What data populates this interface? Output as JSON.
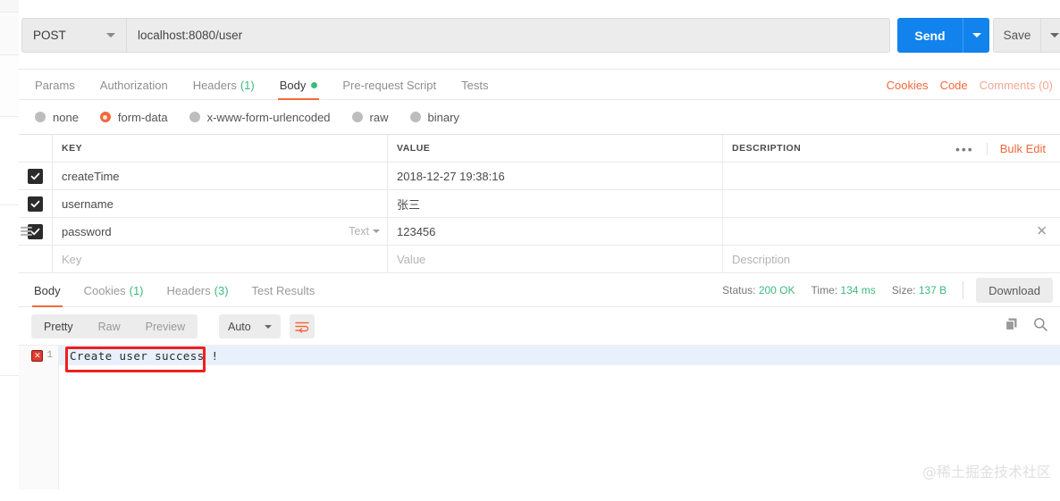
{
  "request": {
    "method": "POST",
    "url": "localhost:8080/user",
    "send_label": "Send",
    "save_label": "Save",
    "tabs": [
      {
        "label": "Params",
        "count": "",
        "active": false
      },
      {
        "label": "Authorization",
        "count": "",
        "active": false
      },
      {
        "label": "Headers",
        "count": "(1)",
        "active": false
      },
      {
        "label": "Body",
        "count": "",
        "active": true,
        "dot": true
      },
      {
        "label": "Pre-request Script",
        "count": "",
        "active": false
      },
      {
        "label": "Tests",
        "count": "",
        "active": false
      }
    ],
    "links": {
      "cookies": "Cookies",
      "code": "Code",
      "comments": "Comments (0)"
    },
    "body_types": [
      {
        "label": "none",
        "selected": false
      },
      {
        "label": "form-data",
        "selected": true
      },
      {
        "label": "x-www-form-urlencoded",
        "selected": false
      },
      {
        "label": "raw",
        "selected": false
      },
      {
        "label": "binary",
        "selected": false
      }
    ],
    "table": {
      "headers": {
        "key": "KEY",
        "value": "VALUE",
        "description": "DESCRIPTION"
      },
      "dots": "•••",
      "bulk_edit": "Bulk Edit",
      "rows": [
        {
          "checked": true,
          "key": "createTime",
          "value": "2018-12-27 19:38:16",
          "description": "",
          "type": "",
          "drag": false,
          "remove": false
        },
        {
          "checked": true,
          "key": "username",
          "value": "张三",
          "description": "",
          "type": "",
          "drag": false,
          "remove": false
        },
        {
          "checked": true,
          "key": "password",
          "value": "123456",
          "description": "",
          "type": "Text",
          "drag": true,
          "remove": true
        }
      ],
      "placeholder_row": {
        "key": "Key",
        "value": "Value",
        "description": "Description"
      }
    }
  },
  "response": {
    "tabs": [
      {
        "label": "Body",
        "count": "",
        "active": true
      },
      {
        "label": "Cookies",
        "count": "(1)",
        "active": false
      },
      {
        "label": "Headers",
        "count": "(3)",
        "active": false
      },
      {
        "label": "Test Results",
        "count": "",
        "active": false
      }
    ],
    "meta": {
      "status_label": "Status:",
      "status_value": "200 OK",
      "time_label": "Time:",
      "time_value": "134 ms",
      "size_label": "Size:",
      "size_value": "137 B"
    },
    "download_label": "Download",
    "view_modes": [
      {
        "label": "Pretty",
        "active": true
      },
      {
        "label": "Raw",
        "active": false
      },
      {
        "label": "Preview",
        "active": false
      }
    ],
    "format": "Auto",
    "body": {
      "line_number": "1",
      "error_glyph": "✕",
      "text": "Create user success !"
    }
  },
  "watermark": "@稀土掘金技术社区",
  "colors": {
    "accent_orange": "#f2683c",
    "send_blue": "#1283ec",
    "status_green": "#3cba7f",
    "highlight_red": "#f01f1f"
  }
}
